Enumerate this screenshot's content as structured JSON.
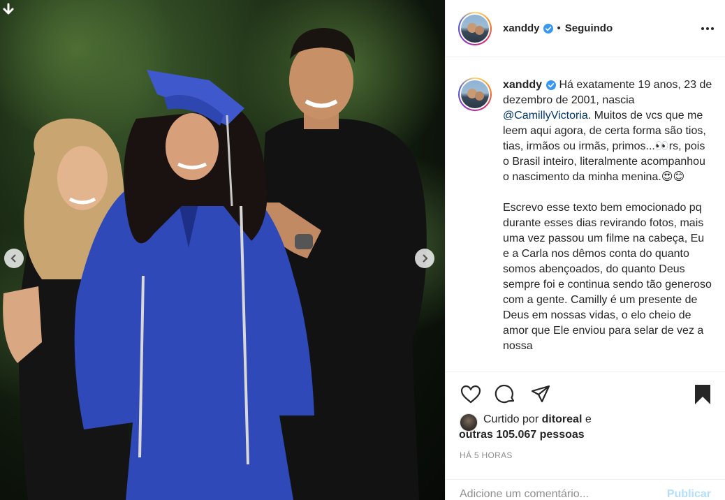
{
  "post": {
    "username": "xanddy",
    "follow_status": "Seguindo",
    "caption": {
      "username": "xanddy",
      "line1": "Há exatamente 19 anos, 23 de dezembro de 2001, nascia ",
      "mention": "@CamillyVictoria",
      "line1_rest": ". Muitos de vcs que me leem aqui agora, de certa forma são tios, tias, irmãos ou irmãs, primos...👀rs, pois o Brasil inteiro, literalmente acompanhou o nascimento da minha menina.😍😊",
      "para2": "Escrevo esse texto bem emocionado pq durante esses dias revirando fotos, mais uma vez passou um filme na cabeça, Eu e a Carla nos dêmos conta do quanto somos abençoados, do quanto Deus sempre foi e continua sendo tão generoso com a gente. Camilly é um presente de Deus em nossas vidas, o elo cheio de amor que Ele enviou para selar de vez a nossa"
    },
    "likes": {
      "prefix": "Curtido por ",
      "user": "ditoreal",
      "connector": " e",
      "others": "outras 105.067 pessoas"
    },
    "time_ago": "HÁ 5 HORAS",
    "comment_placeholder": "Adicione um comentário...",
    "publish_label": "Publicar"
  },
  "icons": {
    "download": "download-arrow-icon",
    "prev": "chevron-left-icon",
    "next": "chevron-right-icon",
    "like": "heart-icon",
    "comment": "comment-icon",
    "share": "send-icon",
    "save": "bookmark-icon",
    "more": "more-options-icon",
    "verified": "verified-badge-icon"
  },
  "colors": {
    "verified": "#3897f0",
    "mention": "#00376b",
    "muted": "#8e8e8e",
    "publish_disabled": "#b2dffc",
    "gown": "#2f49b8"
  }
}
